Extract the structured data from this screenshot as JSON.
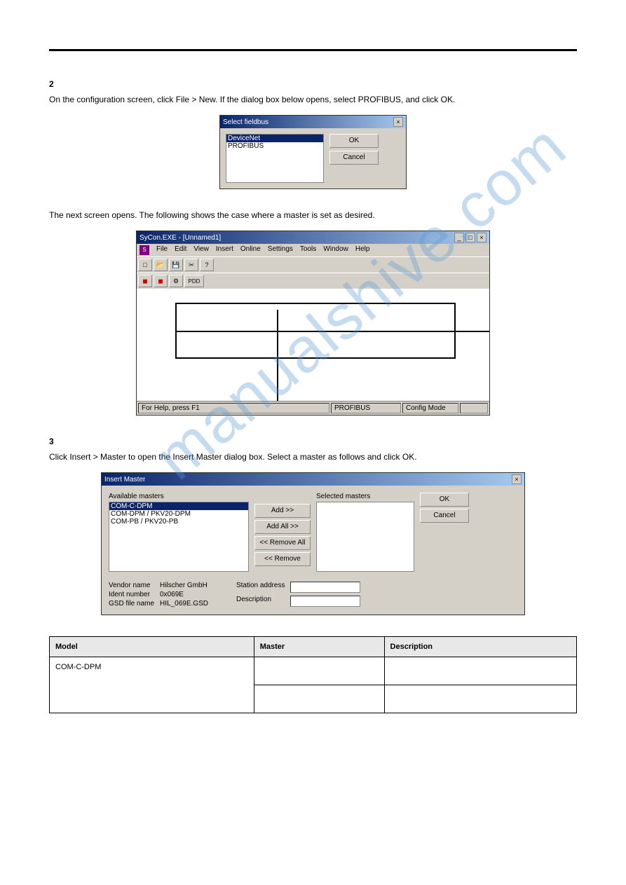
{
  "step2_title": "2",
  "step2_instr": "On the configuration screen, click File > New. If the dialog box below opens, select PROFIBUS, and click OK.",
  "dlg1": {
    "title": "Select fieldbus",
    "opt_selected": "DeviceNet",
    "opt2": "PROFIBUS",
    "ok": "OK",
    "cancel": "Cancel"
  },
  "step3_instr": "The next screen opens. The following shows the case where a master is set as desired.",
  "app": {
    "title": "SyCon.EXE - [Unnamed1]",
    "menu": {
      "file": "File",
      "edit": "Edit",
      "view": "View",
      "insert": "Insert",
      "online": "Online",
      "settings": "Settings",
      "tools": "Tools",
      "window": "Window",
      "help": "Help"
    },
    "status_help": "For Help, press F1",
    "status_bus": "PROFIBUS",
    "status_mode": "Config Mode"
  },
  "step3_title": "3",
  "step3b_instr": "Click Insert > Master to open the Insert Master dialog box. Select a master as follows and click OK.",
  "dlg2": {
    "title": "Insert Master",
    "avail_label": "Available masters",
    "avail_sel": "COM-C-DPM",
    "avail_opt2": "COM-DPM / PKV20-DPM",
    "avail_opt3": "COM-PB / PKV20-PB",
    "add": "Add >>",
    "addall": "Add All >>",
    "removeall": "<< Remove All",
    "remove": "<< Remove",
    "sel_label": "Selected masters",
    "ok": "OK",
    "cancel": "Cancel",
    "vendor_lbl": "Vendor name",
    "vendor_val": "Hilscher GmbH",
    "ident_lbl": "Ident number",
    "ident_val": "0x069E",
    "gsd_lbl": "GSD file name",
    "gsd_val": "HIL_069E.GSD",
    "station_lbl": "Station address",
    "desc_lbl": "Description"
  },
  "tbl": {
    "h1": "Model",
    "h2": "Master",
    "h3": "Description",
    "r1c1": "COM-C-DPM",
    "r1c2": "",
    "r1c3": "",
    "r2c2": "",
    "r2c3": ""
  },
  "watermark": "manualshive.com"
}
